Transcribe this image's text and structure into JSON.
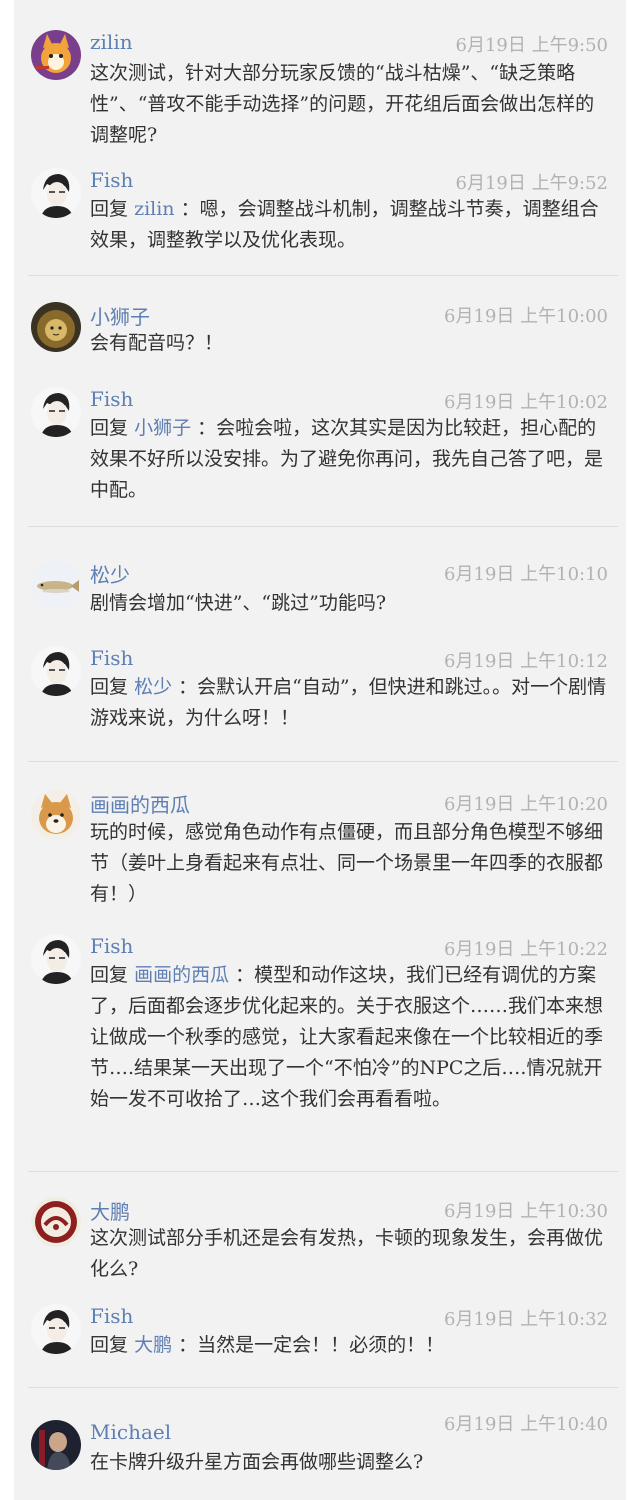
{
  "threads": [
    {
      "question": {
        "user": "zilin",
        "time": "6月19日 上午9:50",
        "avatar": "fox-avatar",
        "text": "这次测试，针对大部分玩家反馈的“战斗枯燥”、“缺乏策略性”、“普攻不能手动选择”的问题，开花组后面会做出怎样的调整呢?"
      },
      "answer": {
        "user": "Fish",
        "time": "6月19日 上午9:52",
        "reply_prefix": "回复",
        "reply_to": "zilin",
        "sep": "：",
        "text": "嗯，会调整战斗机制，调整战斗节奏，调整组合效果，调整教学以及优化表现。"
      }
    },
    {
      "question": {
        "user": "小狮子",
        "time": "6月19日 上午10:00",
        "avatar": "lion-avatar",
        "text": "会有配音吗？！"
      },
      "answer": {
        "user": "Fish",
        "time": "6月19日 上午10:02",
        "reply_prefix": "回复",
        "reply_to": "小狮子",
        "sep": "：",
        "text": "会啦会啦，这次其实是因为比较赶，担心配的效果不好所以没安排。为了避免你再问，我先自己答了吧，是中配。"
      }
    },
    {
      "question": {
        "user": "松少",
        "time": "6月19日 上午10:10",
        "avatar": "fish-avatar",
        "text": "剧情会增加“快进”、“跳过”功能吗?"
      },
      "answer": {
        "user": "Fish",
        "time": "6月19日 上午10:12",
        "reply_prefix": "回复",
        "reply_to": "松少",
        "sep": "：",
        "text": "会默认开启“自动”，但快进和跳过。。对一个剧情游戏来说，为什么呀！！"
      }
    },
    {
      "question": {
        "user": "画画的西瓜",
        "time": "6月19日 上午10:20",
        "avatar": "shiba-avatar",
        "text": "玩的时候，感觉角色动作有点僵硬，而且部分角色模型不够细节（姜叶上身看起来有点壮、同一个场景里一年四季的衣服都有！）"
      },
      "answer": {
        "user": "Fish",
        "time": "6月19日 上午10:22",
        "reply_prefix": "回复",
        "reply_to": "画画的西瓜",
        "sep": "：",
        "text": "模型和动作这块，我们已经有调优的方案了，后面都会逐步优化起来的。关于衣服这个……我们本来想让做成一个秋季的感觉，让大家看起来像在一个比较相近的季节….结果某一天出现了一个“不怕冷”的NPC之后….情况就开始一发不可收拾了…这个我们会再看看啦。"
      }
    },
    {
      "question": {
        "user": "大鹏",
        "time": "6月19日 上午10:30",
        "avatar": "emblem-avatar",
        "text": "这次测试部分手机还是会有发热，卡顿的现象发生，会再做优化么?"
      },
      "answer": {
        "user": "Fish",
        "time": "6月19日 上午10:32",
        "reply_prefix": "回复",
        "reply_to": "大鹏",
        "sep": "：",
        "text": "当然是一定会！！必须的！！"
      }
    },
    {
      "question": {
        "user": "Michael",
        "time": "6月19日 上午10:40",
        "avatar": "warrior-avatar",
        "text": "在卡牌升级升星方面会再做哪些调整么?"
      }
    }
  ],
  "colors": {
    "name": "#5e7fb3",
    "time": "#b2b2b2",
    "text": "#333333",
    "panel": "#f2f2f2",
    "divider": "#dcdcdc"
  }
}
